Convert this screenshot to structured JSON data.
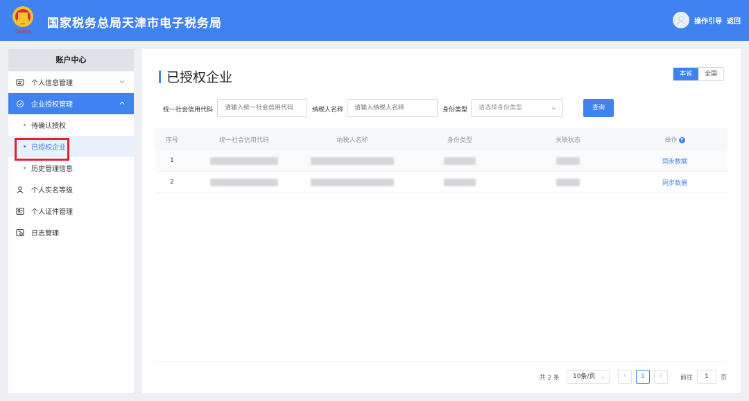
{
  "header": {
    "title": "国家税务总局天津市电子税务局",
    "guide_label": "操作引导",
    "back_label": "返回"
  },
  "sidebar": {
    "title": "账户中心",
    "items": [
      {
        "label": "个人信息管理",
        "icon": "id-card-icon"
      },
      {
        "label": "企业授权管理",
        "icon": "check-circle-icon"
      },
      {
        "label": "个人实名等级",
        "icon": "person-icon"
      },
      {
        "label": "个人证件管理",
        "icon": "certificate-icon"
      },
      {
        "label": "日志管理",
        "icon": "log-icon"
      }
    ],
    "sub_items": [
      {
        "label": "待确认授权"
      },
      {
        "label": "已授权企业"
      },
      {
        "label": "历史管理信息"
      }
    ]
  },
  "main": {
    "title": "已授权企业",
    "scope": [
      "本省",
      "全国"
    ],
    "filters": {
      "credit_code_label": "统一社会信用代码",
      "credit_code_placeholder": "请输入统一社会信用代码",
      "taxpayer_name_label": "纳税人名称",
      "taxpayer_name_placeholder": "请输入纳税人名称",
      "identity_type_label": "身份类型",
      "identity_type_placeholder": "请选择身份类型",
      "query_label": "查询"
    },
    "table": {
      "headers": [
        "序号",
        "统一社会信用代码",
        "纳税人名称",
        "身份类型",
        "关联状态",
        "操作"
      ],
      "rows": [
        {
          "index": "1",
          "action": "同步数据"
        },
        {
          "index": "2",
          "action": "同步数据"
        }
      ]
    },
    "pager": {
      "total": "共 2 条",
      "page_size": "10条/页",
      "current_page": "1",
      "goto_label": "前往",
      "goto_value": "1",
      "page_suffix": "页"
    }
  },
  "colors": {
    "primary": "#3f82f0",
    "highlight_box": "#e4202c"
  }
}
